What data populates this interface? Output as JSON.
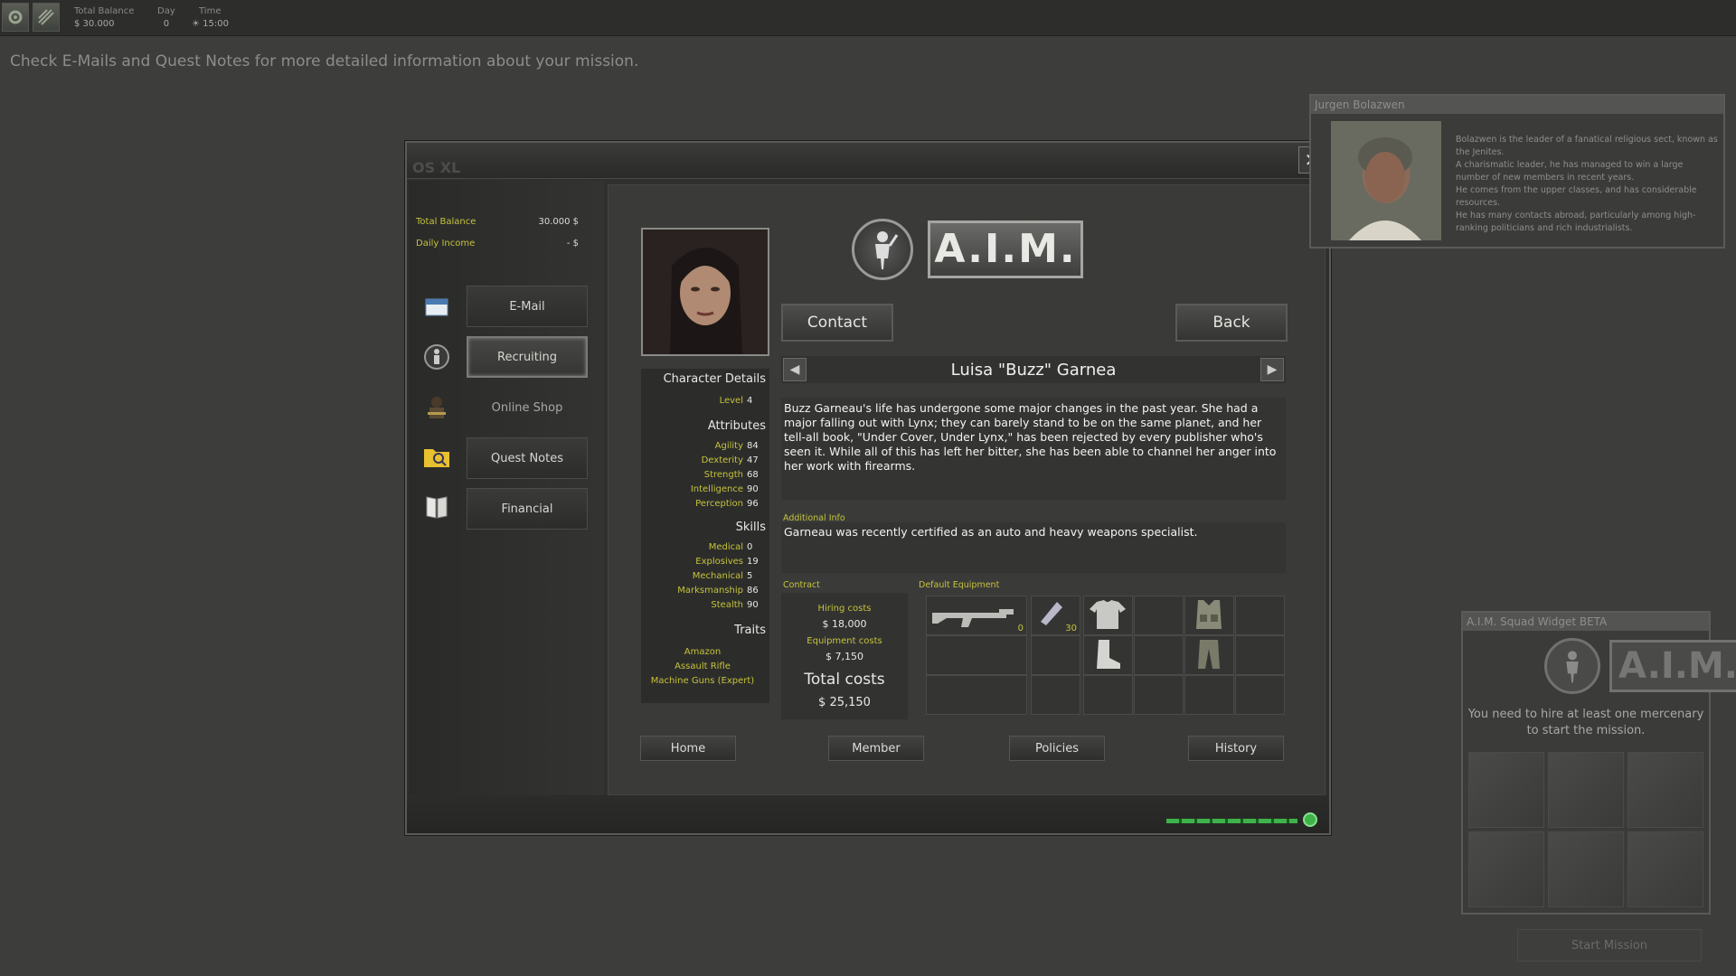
{
  "topbar": {
    "total_balance_label": "Total Balance",
    "total_balance_value": "$ 30.000",
    "day_label": "Day",
    "day_value": "0",
    "time_label": "Time",
    "time_value": "15:00"
  },
  "hint": "Check E-Mails and Quest Notes for more detailed information about your mission.",
  "laptop": {
    "os_title": "OS XL",
    "close_glyph": "✕",
    "balance": {
      "total_label": "Total Balance",
      "total_value": "30.000 $",
      "income_label": "Daily Income",
      "income_value": "- $"
    },
    "nav": [
      {
        "label": "E-Mail",
        "icon": "email-icon"
      },
      {
        "label": "Recruiting",
        "icon": "aim-icon"
      },
      {
        "label": "Online Shop",
        "icon": "shop-icon"
      },
      {
        "label": "Quest Notes",
        "icon": "folder-icon"
      },
      {
        "label": "Financial",
        "icon": "book-icon"
      }
    ]
  },
  "aim": {
    "logo_text": "A.I.M.",
    "contact_label": "Contact",
    "back_label": "Back",
    "prev_glyph": "◀",
    "next_glyph": "▶",
    "merc_name": "Luisa \"Buzz\" Garnea",
    "details": {
      "heading": "Character Details",
      "level_label": "Level",
      "level_value": "4",
      "attributes_heading": "Attributes",
      "attributes": [
        {
          "name": "Agility",
          "value": "84"
        },
        {
          "name": "Dexterity",
          "value": "47"
        },
        {
          "name": "Strength",
          "value": "68"
        },
        {
          "name": "Intelligence",
          "value": "90"
        },
        {
          "name": "Perception",
          "value": "96"
        }
      ],
      "skills_heading": "Skills",
      "skills": [
        {
          "name": "Medical",
          "value": "0"
        },
        {
          "name": "Explosives",
          "value": "19"
        },
        {
          "name": "Mechanical",
          "value": "5"
        },
        {
          "name": "Marksmanship",
          "value": "86"
        },
        {
          "name": "Stealth",
          "value": "90"
        }
      ],
      "traits_heading": "Traits",
      "traits": [
        "Amazon",
        "Assault Rifle",
        "Machine Guns (Expert)"
      ]
    },
    "bio": "Buzz Garneau's life has undergone some major changes in the past year. She had a major falling out with Lynx; they can barely stand to be on the same planet, and her tell-all book, \"Under Cover, Under Lynx,\" has been rejected by every publisher who's seen it. While all of this has left her bitter, she has been able to channel her anger into her work with firearms.",
    "additional_info_label": "Additional Info",
    "additional_info": "Garneau was recently certified as an auto and heavy weapons specialist.",
    "contract": {
      "label": "Contract",
      "hiring_label": "Hiring costs",
      "hiring_value": "$ 18,000",
      "equipment_label": "Equipment costs",
      "equipment_value": "$ 7,150",
      "total_label": "Total costs",
      "total_value": "$ 25,150"
    },
    "equipment_label": "Default Equipment",
    "equipment_counts": [
      "0",
      "30"
    ],
    "tabs": [
      "Home",
      "Member",
      "Policies",
      "History"
    ]
  },
  "npc": {
    "name": "Jurgen Bolazwen",
    "description": "Bolazwen is the leader of a fanatical religious sect, known as the Jenites.\nA charismatic leader, he has managed to win a large number of new members in recent years.\nHe comes from the upper classes, and has considerable resources.\nHe has many contacts abroad, particularly among high-ranking politicians and rich industrialists."
  },
  "squad": {
    "title": "A.I.M. Squad Widget BETA",
    "logo_text": "A.I.M.",
    "message": "You need to hire at least one mercenary to start the mission.",
    "start_label": "Start Mission"
  },
  "colors": {
    "accent_yellow": "#c6c23a",
    "progress_green": "#3eb34a"
  }
}
